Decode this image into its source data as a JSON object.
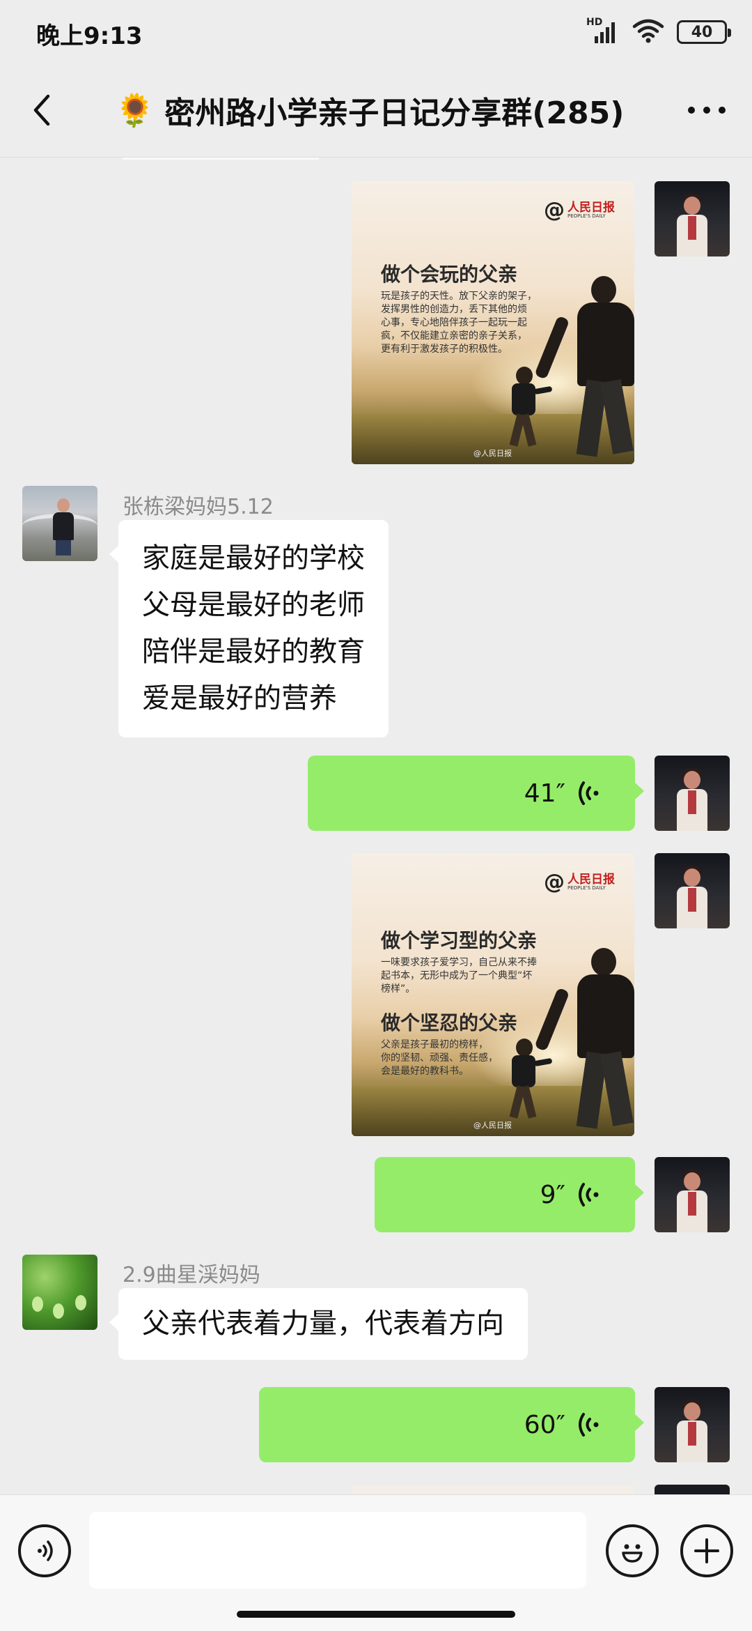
{
  "status_bar": {
    "time": "晚上9:13",
    "network_label": "HD",
    "battery": "40",
    "icons": [
      "signal-icon",
      "wifi-icon",
      "battery-icon"
    ]
  },
  "header": {
    "title_emoji": "🌻",
    "title": "密州路小学亲子日记分享群(285)",
    "icons": [
      "back-icon",
      "more-icon"
    ]
  },
  "messages": [
    {
      "type": "image",
      "from": "self",
      "image": {
        "logo_at": "@",
        "logo_cn": "人民日报",
        "logo_en": "PEOPLE'S DAILY",
        "heading": "做个会玩的父亲",
        "body_lines": [
          "玩是孩子的天性。放下父亲的架子，",
          "发挥男性的创造力，丢下其他的烦",
          "心事，专心地陪伴孩子一起玩一起",
          "疯，不仅能建立亲密的亲子关系，",
          "更有利于激发孩子的积极性。"
        ],
        "credit": "@人民日报"
      }
    },
    {
      "type": "text",
      "from": "other",
      "sender": "张栋梁妈妈5.12",
      "lines": [
        "家庭是最好的学校",
        "父母是最好的老师",
        "陪伴是最好的教育",
        "爱是最好的营养"
      ]
    },
    {
      "type": "voice",
      "from": "self",
      "duration": "41″"
    },
    {
      "type": "image",
      "from": "self",
      "image": {
        "logo_at": "@",
        "logo_cn": "人民日报",
        "logo_en": "PEOPLE'S DAILY",
        "heading": "做个学习型的父亲",
        "body_lines": [
          "一味要求孩子爱学习，自己从来不捧",
          "起书本，无形中成为了一个典型“坏",
          "榜样”。"
        ],
        "heading2": "做个坚忍的父亲",
        "body2_lines": [
          "父亲是孩子最初的榜样，",
          "你的坚韧、顽强、责任感，",
          "会是最好的教科书。"
        ],
        "credit": "@人民日报"
      }
    },
    {
      "type": "voice",
      "from": "self",
      "duration": "9″"
    },
    {
      "type": "text",
      "from": "other",
      "sender": "2.9曲星渓妈妈",
      "lines": [
        "父亲代表着力量，代表着方向"
      ]
    },
    {
      "type": "voice",
      "from": "self",
      "duration": "60″"
    }
  ],
  "input_bar": {
    "value": "",
    "icons": [
      "voice-input-icon",
      "emoji-icon",
      "plus-icon"
    ]
  },
  "colors": {
    "background": "#ededed",
    "self_bubble": "#95ec69",
    "other_bubble": "#ffffff",
    "sender_name": "#8a8a8a"
  }
}
